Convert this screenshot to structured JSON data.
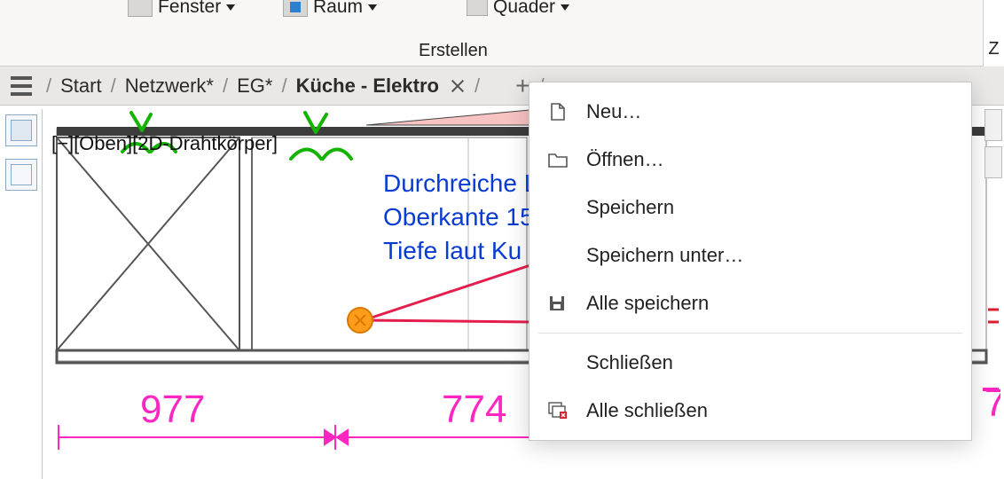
{
  "ribbon": {
    "fenster": "Fenster",
    "raum": "Raum",
    "quader": "Quader",
    "group_label": "Erstellen",
    "right_edge": "Z"
  },
  "breadcrumb": {
    "start": "Start",
    "netzwerk": "Netzwerk*",
    "eg": "EG*",
    "active": "Küche - Elektro"
  },
  "drawing": {
    "view_label": "[−][Oben][2D-Drahtkörper]",
    "annotation_line1": "Durchreiche L",
    "annotation_line2": "Oberkante 15",
    "annotation_line3": "Tiefe laut Ku",
    "dim_left": "977",
    "dim_right": "774"
  },
  "context_menu": {
    "neu": "Neu…",
    "oeffnen": "Öffnen…",
    "speichern": "Speichern",
    "speichern_unter": "Speichern unter…",
    "alle_speichern": "Alle speichern",
    "schliessen": "Schließen",
    "alle_schliessen": "Alle schließen"
  }
}
